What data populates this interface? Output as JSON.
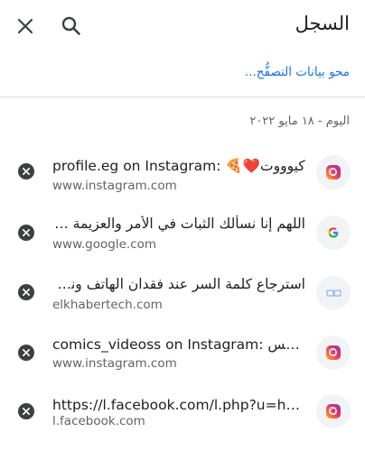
{
  "header": {
    "title": "السجل",
    "close_icon": "close-icon",
    "search_icon": "search-icon"
  },
  "clear_browsing_data": "محو بيانات التصفُّح...",
  "date_header": "اليوم - ١٨ مايو ٢٠٢٢",
  "colors": {
    "link": "#1a73e8",
    "text": "#202124",
    "secondary": "#5f6368",
    "remove_button": "#3c4043"
  },
  "history": [
    {
      "title": "profile.eg on Instagram: 🍕❤️كيوووت",
      "url": "www.instagram.com",
      "favicon": "instagram-icon"
    },
    {
      "title": "اللهم إنا نسألك الثبات في الأمر والعزيمة على ا...",
      "url": "www.google.com",
      "favicon": "google-icon"
    },
    {
      "title": "استرجاع كلمة السر عند فقدان الهاتف ونسيان...",
      "url": "elkhabertech.com",
      "favicon": "site-icon"
    },
    {
      "title": "comics_videoss on Instagram: لتمس...",
      "url": "www.instagram.com",
      "favicon": "instagram-icon"
    },
    {
      "title": "https://l.facebook.com/l.php?u=htt...",
      "url": "l.facebook.com",
      "favicon": "instagram-icon"
    }
  ]
}
